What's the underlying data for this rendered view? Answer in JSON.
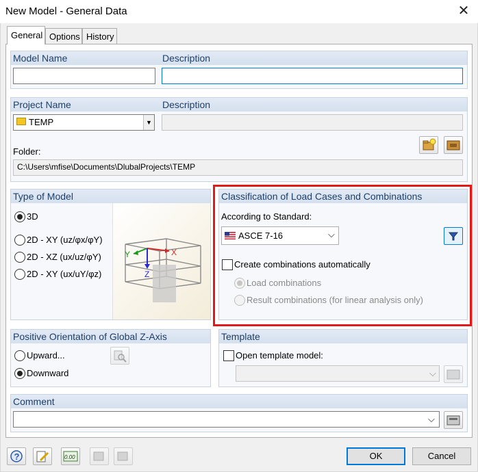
{
  "window": {
    "title": "New Model - General Data",
    "close_glyph": "✕"
  },
  "tabs": [
    {
      "label": "General",
      "active": true
    },
    {
      "label": "Options",
      "active": false
    },
    {
      "label": "History",
      "active": false
    }
  ],
  "model": {
    "name_label": "Model Name",
    "name_value": "",
    "description_label": "Description",
    "description_value": ""
  },
  "project": {
    "name_label": "Project Name",
    "selected": "TEMP",
    "description_label": "Description",
    "description_value": "",
    "folder_label": "Folder:",
    "folder_value": "C:\\Users\\mfise\\Documents\\DlubalProjects\\TEMP"
  },
  "type_of_model": {
    "header": "Type of Model",
    "options": [
      {
        "label": "3D",
        "selected": true
      },
      {
        "label": "2D - XY (uz/φx/φY)",
        "selected": false
      },
      {
        "label": "2D - XZ (ux/uz/φY)",
        "selected": false
      },
      {
        "label": "2D - XY (ux/uY/φz)",
        "selected": false
      }
    ],
    "axis_labels": {
      "x": "X",
      "y": "Y",
      "z": "Z"
    }
  },
  "classification": {
    "header": "Classification of Load Cases and Combinations",
    "standard_label": "According to Standard:",
    "standard_value": "ASCE 7-16",
    "create_auto_label": "Create combinations automatically",
    "create_auto_checked": false,
    "sub_options": [
      {
        "label": "Load combinations",
        "selected": true
      },
      {
        "label": "Result combinations (for linear analysis only)",
        "selected": false
      }
    ]
  },
  "orientation": {
    "header": "Positive Orientation of Global Z-Axis",
    "options": [
      {
        "label": "Upward...",
        "selected": false
      },
      {
        "label": "Downward",
        "selected": true
      }
    ]
  },
  "template": {
    "header": "Template",
    "open_label": "Open template model:",
    "open_checked": false,
    "value": ""
  },
  "comment": {
    "header": "Comment",
    "value": ""
  },
  "footer": {
    "ok_label": "OK",
    "cancel_label": "Cancel",
    "units_icon_text": "0.00"
  },
  "colors": {
    "accent": "#0078d7",
    "highlight_border": "#e01919",
    "group_header_text": "#1f3f66",
    "folder_icon": "#f3c623"
  }
}
